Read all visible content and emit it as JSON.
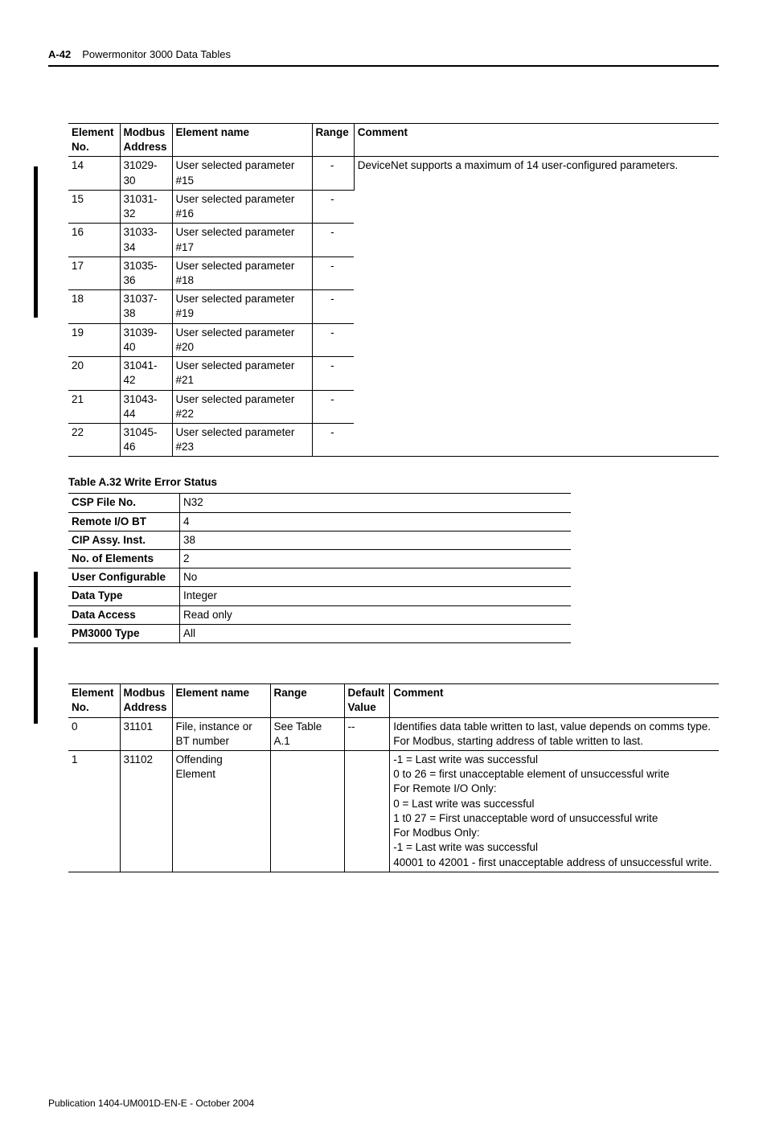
{
  "header": {
    "pageNum": "A-42",
    "section": "Powermonitor 3000 Data Tables"
  },
  "t1": {
    "head": [
      "Element No.",
      "Modbus Address",
      "Element name",
      "Range",
      "Comment"
    ],
    "commentTop": "DeviceNet supports a maximum of 14 user-configured parameters.",
    "rows": [
      {
        "el": "14",
        "mb": "31029-30",
        "nm": "User selected parameter #15",
        "rn": "-"
      },
      {
        "el": "15",
        "mb": "31031-32",
        "nm": "User selected parameter #16",
        "rn": "-"
      },
      {
        "el": "16",
        "mb": "31033-34",
        "nm": "User selected parameter #17",
        "rn": "-"
      },
      {
        "el": "17",
        "mb": "31035-36",
        "nm": "User selected parameter #18",
        "rn": "-"
      },
      {
        "el": "18",
        "mb": "31037-38",
        "nm": "User selected parameter #19",
        "rn": "-"
      },
      {
        "el": "19",
        "mb": "31039-40",
        "nm": "User selected parameter #20",
        "rn": "-"
      },
      {
        "el": "20",
        "mb": "31041-42",
        "nm": "User selected parameter #21",
        "rn": "-"
      },
      {
        "el": "21",
        "mb": "31043-44",
        "nm": "User selected parameter #22",
        "rn": "-"
      },
      {
        "el": "22",
        "mb": "31045-46",
        "nm": "User selected parameter #23",
        "rn": "-"
      }
    ]
  },
  "t2": {
    "title": "Table A.32 Write Error Status",
    "rows": [
      [
        "CSP File No.",
        "N32"
      ],
      [
        "Remote I/O BT",
        "4"
      ],
      [
        "CIP Assy. Inst.",
        "38"
      ],
      [
        "No. of Elements",
        "2"
      ],
      [
        "User Configurable",
        "No"
      ],
      [
        "Data Type",
        "Integer"
      ],
      [
        "Data Access",
        "Read only"
      ],
      [
        "PM3000 Type",
        "All"
      ]
    ]
  },
  "t3": {
    "head": [
      "Element No.",
      "Modbus Address",
      "Element name",
      "Range",
      "Default Value",
      "Comment"
    ],
    "rows": [
      {
        "el": "0",
        "mb": "31101",
        "nm": "File, instance or BT number",
        "rn": "See Table A.1",
        "df": "--",
        "ct": "Identifies data table written to last, value depends on comms type. For Modbus, starting address of table written to last."
      },
      {
        "el": "1",
        "mb": "31102",
        "nm": "Offending Element",
        "rn": "",
        "df": "",
        "ct": "-1 = Last write was successful\n0 to 26 = first unacceptable element of unsuccessful write\nFor Remote I/O Only:\n0 = Last write was successful\n1 t0 27 = First unacceptable word of unsuccessful write\nFor Modbus Only:\n-1 = Last write was successful\n40001 to 42001 - first unacceptable address of unsuccessful write."
      }
    ]
  },
  "footer": {
    "pub": "Publication 1404-UM001D-EN-E - October 2004"
  }
}
